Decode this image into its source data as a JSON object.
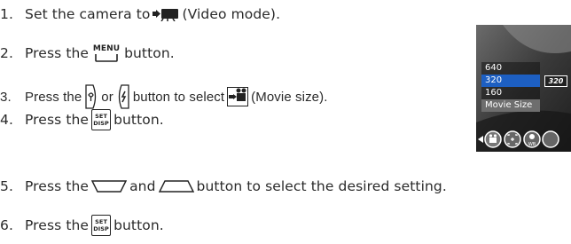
{
  "steps": [
    {
      "num": "1.",
      "pre": "Set the camera to",
      "post": "(Video mode)."
    },
    {
      "num": "2.",
      "pre": "Press the",
      "post": "button."
    },
    {
      "num": "3.",
      "pre": "Press the",
      "mid1": "or",
      "mid2": "button to select",
      "post": "(Movie size)."
    },
    {
      "num": "4.",
      "pre": "Press the",
      "post": "button."
    },
    {
      "num": "5.",
      "pre": "Press the",
      "mid1": "and",
      "post": "button to select the desired setting."
    },
    {
      "num": "6.",
      "pre": "Press the",
      "post": "button."
    }
  ],
  "keys": {
    "menu_label": "MENU",
    "set_label_top": "SET",
    "set_label_bottom": "DISP"
  },
  "lcd": {
    "options": [
      "640",
      "320",
      "160"
    ],
    "selected": "320",
    "caption": "Movie Size",
    "badge": "320",
    "icons": [
      "back-arrow-icon",
      "movie-size-icon",
      "focus-icon",
      "white-balance-icon",
      "more-icon"
    ]
  },
  "colors": {
    "text": "#2a2a2a",
    "highlight": "#1d5fc2"
  }
}
